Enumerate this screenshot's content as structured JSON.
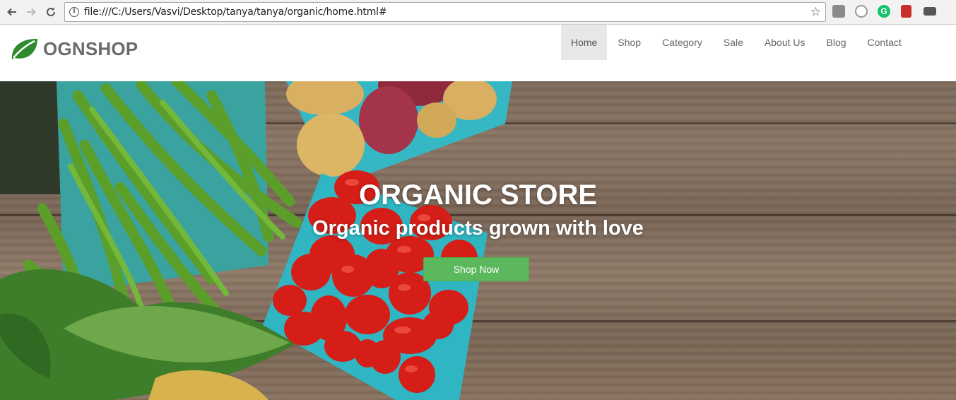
{
  "browser": {
    "url": "file:///C:/Users/Vasvi/Desktop/tanya/tanya/organic/home.html#",
    "extensions": [
      "extension-gray-icon",
      "skype-icon",
      "grammarly-icon",
      "bookmark-red-icon",
      "extension-dark-icon"
    ]
  },
  "site": {
    "logo_text": "OGNSHOP",
    "menu": [
      {
        "label": "Home",
        "active": true
      },
      {
        "label": "Shop"
      },
      {
        "label": "Category"
      },
      {
        "label": "Sale"
      },
      {
        "label": "About Us"
      },
      {
        "label": "Blog"
      },
      {
        "label": "Contact"
      }
    ]
  },
  "hero": {
    "title": "ORGANIC STORE",
    "subtitle": "Organic products grown with love",
    "button_label": "Shop Now"
  },
  "colors": {
    "accent_green": "#5cb85c",
    "leaf_green": "#2e8b2e",
    "logo_gray": "#6b6b6b",
    "active_menu_bg": "#e7e7e7"
  }
}
